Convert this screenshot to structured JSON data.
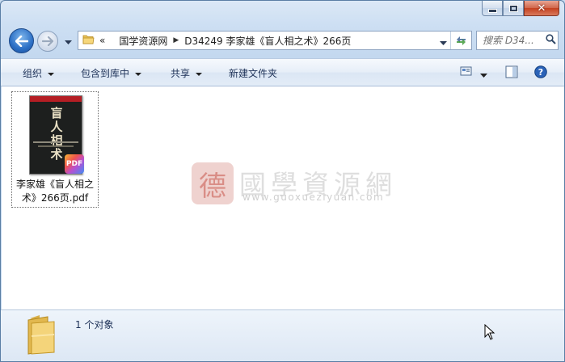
{
  "window": {
    "caption_close_glyph": "✕"
  },
  "nav": {
    "breadcrumb_prefix": "«",
    "breadcrumb": [
      "国学资源网",
      "D34249 李家雄《盲人相之术》266页"
    ],
    "separator": "▶",
    "search_placeholder": "搜索 D34...",
    "search_value": ""
  },
  "toolbar": {
    "organize": "组织",
    "include_library": "包含到库中",
    "share": "共享",
    "new_folder": "新建文件夹"
  },
  "file": {
    "name": "李家雄《盲人相之术》266页.pdf",
    "thumb_title": "盲人相术",
    "badge": "PDF"
  },
  "watermark": {
    "logo_glyph": "德",
    "text": "國學資源網",
    "url": "www.guoxueziyuan.com"
  },
  "status": {
    "count": "1 个对象"
  },
  "colors": {
    "window_frame": "#5a7ea5",
    "toolbar_text": "#1e3258",
    "close_button": "#c4401f"
  }
}
